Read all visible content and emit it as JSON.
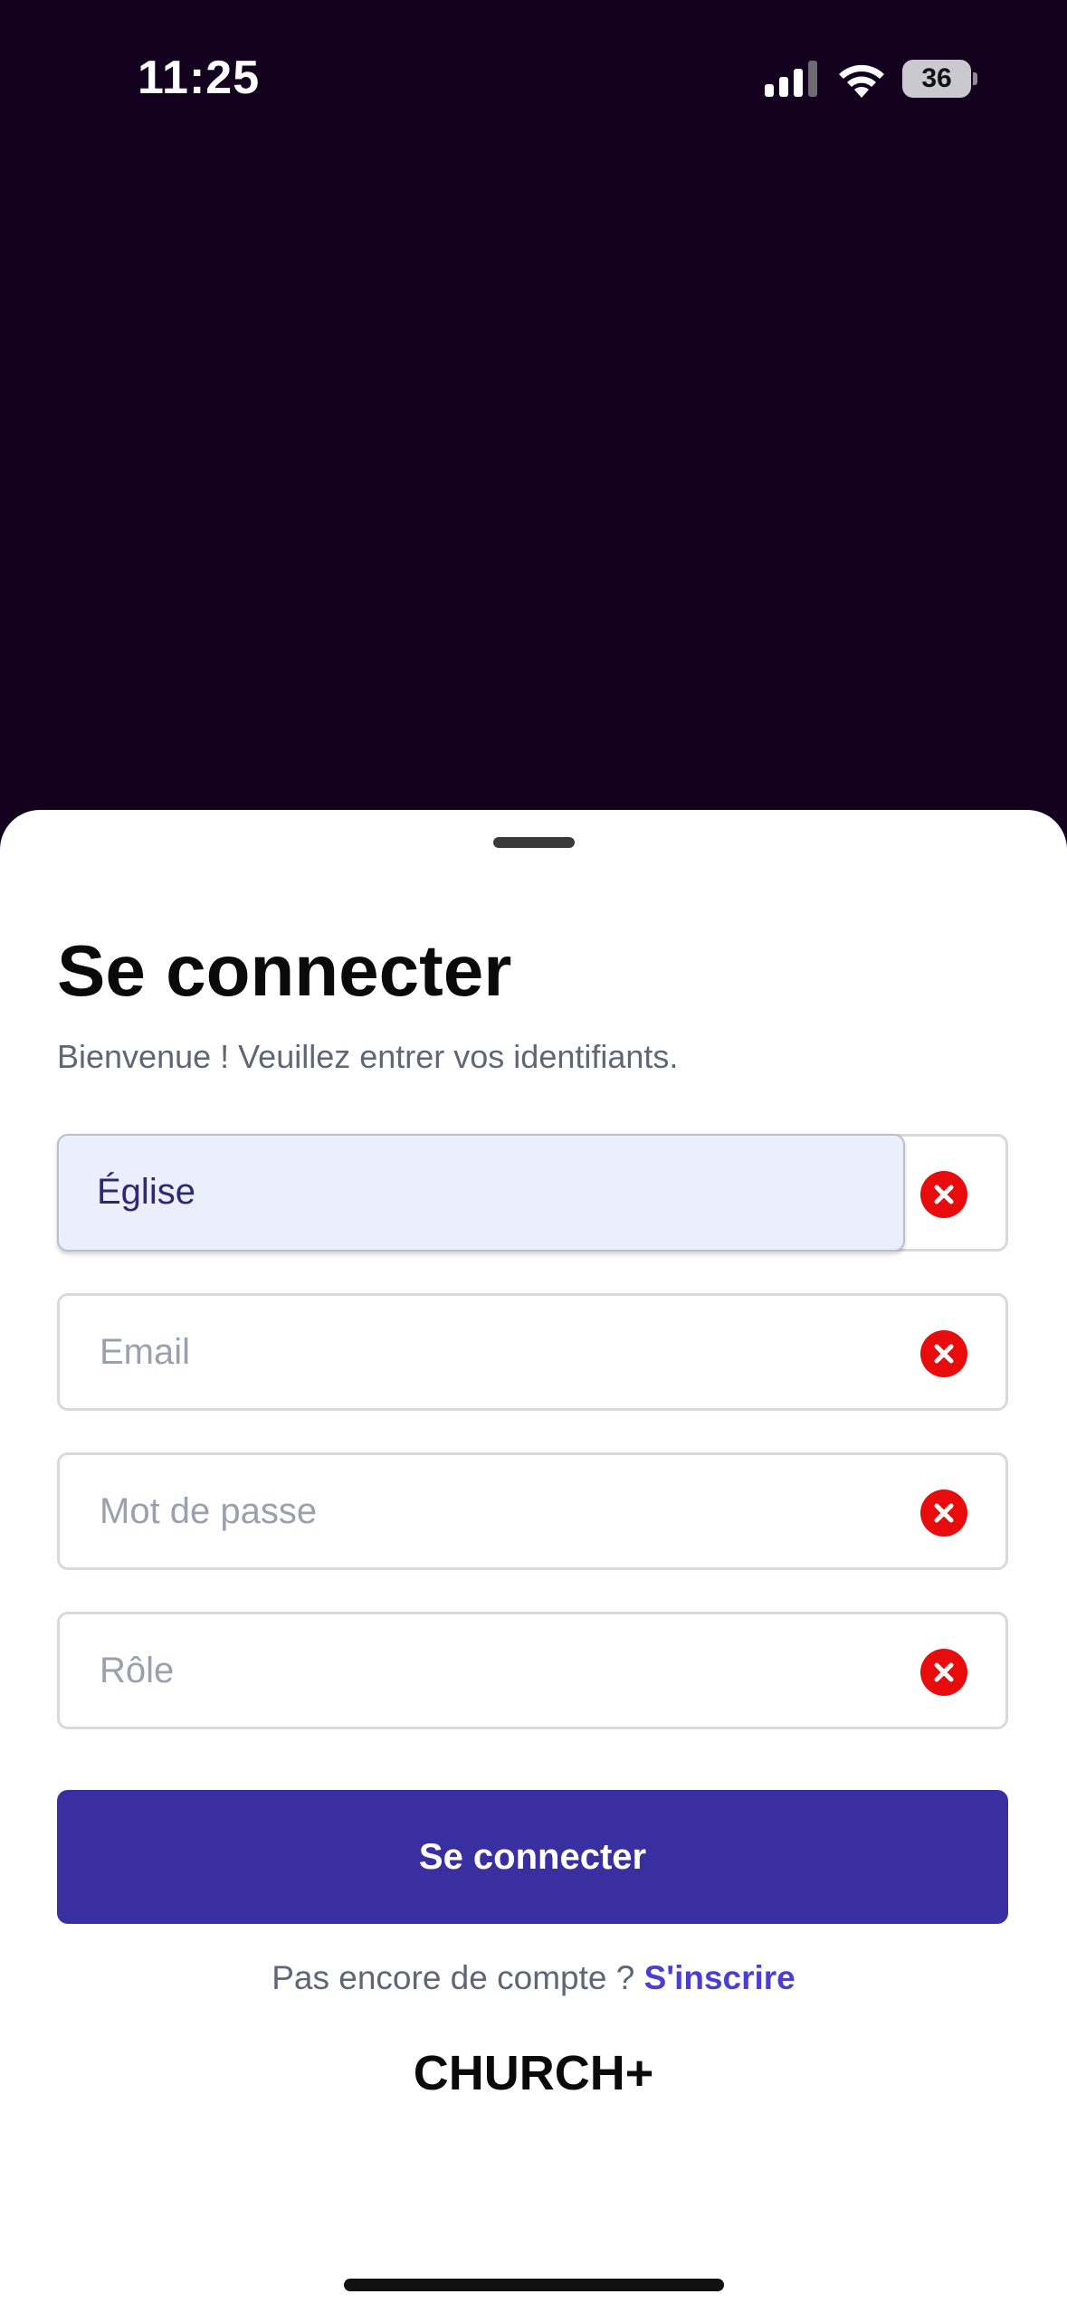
{
  "status_bar": {
    "time": "11:25",
    "battery_level": "36",
    "icons": [
      "signal-icon",
      "wifi-icon",
      "battery-icon"
    ]
  },
  "login": {
    "title": "Se connecter",
    "subtitle": "Bienvenue ! Veuillez entrer vos identifiants.",
    "fields": [
      {
        "value": "Église",
        "placeholder": "",
        "active": true
      },
      {
        "value": "",
        "placeholder": "Email"
      },
      {
        "value": "",
        "placeholder": "Mot de passe"
      },
      {
        "value": "",
        "placeholder": "Rôle"
      }
    ],
    "clear_icon": "clear-x-circle-icon",
    "submit_label": "Se connecter",
    "signup_prompt": "Pas encore de compte ?",
    "signup_link": "S'inscrire"
  },
  "brand": "CHURCH+",
  "colors": {
    "background": "#14001f",
    "primary_button": "#3a2fa0",
    "link": "#4b3fd1",
    "clear_icon": "#e80c0c",
    "active_field": "#e9effc"
  }
}
